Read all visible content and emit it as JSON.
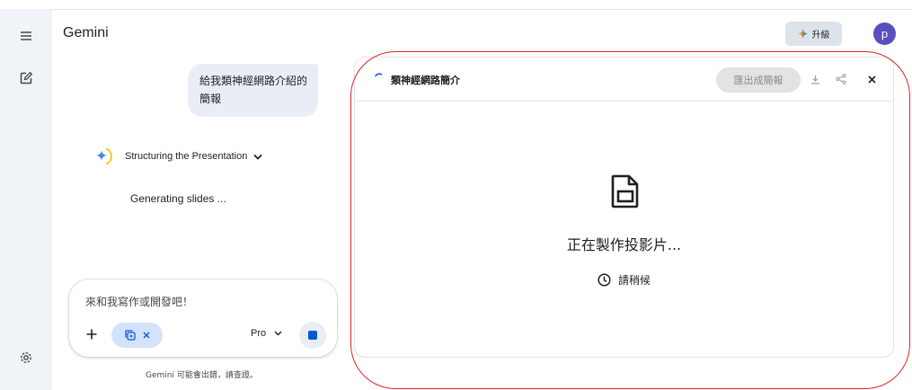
{
  "app": {
    "title": "Gemini"
  },
  "header": {
    "upgrade_label": "升級",
    "avatar_initial": "p"
  },
  "chat": {
    "user_message": "給我類神經網路介紹的簡報",
    "thinking_label": "Structuring the Presentation",
    "status": "Generating slides ..."
  },
  "input": {
    "placeholder": "來和我寫作或開發吧！",
    "model": "Pro"
  },
  "disclaimer": "Gemini 可能會出錯，請查證。",
  "canvas": {
    "title": "類神經網路簡介",
    "export_label": "匯出成簡報",
    "making_label": "正在製作投影片...",
    "wait_label": "請稍候"
  },
  "colors": {
    "accent": "#0b57d0",
    "avatar": "#5b4fbe",
    "highlight": "#e52222"
  },
  "icons": [
    "menu-icon",
    "new-chat-icon",
    "settings-icon",
    "sparkle-icon",
    "chevron-down-icon",
    "plus-icon",
    "tool-icon",
    "close-icon",
    "stop-icon",
    "spinner-icon",
    "download-icon",
    "share-icon",
    "slides-document-icon",
    "clock-icon"
  ]
}
